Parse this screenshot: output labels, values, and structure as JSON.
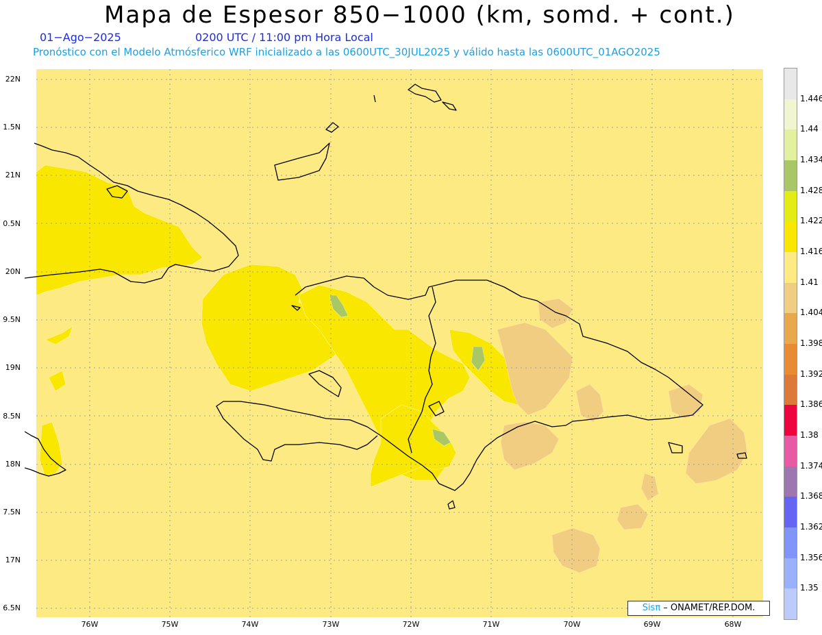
{
  "header": {
    "title": "Mapa de Espesor 850−1000 (km, somd. + cont.)",
    "date": "01−Ago−2025",
    "time": "0200 UTC / 11:00 pm Hora Local",
    "subtitle": "Pronóstico con el Modelo Atmósferico WRF inicializado a las 0600UTC_30JUL2025 y válido hasta las  0600UTC_01AGO2025"
  },
  "axes": {
    "lat_labels": [
      "22N",
      "1.5N",
      "21N",
      "0.5N",
      "20N",
      "9.5N",
      "19N",
      "8.5N",
      "18N",
      "7.5N",
      "17N",
      "6.5N"
    ],
    "lon_labels": [
      "76W",
      "75W",
      "74W",
      "73W",
      "72W",
      "71W",
      "70W",
      "69W",
      "68W"
    ]
  },
  "legend": {
    "levels": [
      "1.446",
      "1.44",
      "1.434",
      "1.428",
      "1.422",
      "1.416",
      "1.41",
      "1.404",
      "1.398",
      "1.392",
      "1.386",
      "1.38",
      "1.374",
      "1.368",
      "1.362",
      "1.356",
      "1.35"
    ],
    "colors": [
      "#e8e8e8",
      "#f1f6d0",
      "#e2f1a0",
      "#a9c765",
      "#e3ec14",
      "#f9e700",
      "#fdea82",
      "#f1cd82",
      "#eaa84c",
      "#e88c34",
      "#dd7a3a",
      "#ee0540",
      "#e95aa4",
      "#9e76b0",
      "#6465f2",
      "#8194f8",
      "#9ab2fd",
      "#bccbfc"
    ]
  },
  "credit": {
    "brand": "Sisπ",
    "text": " – ONAMET/REP.DOM."
  }
}
